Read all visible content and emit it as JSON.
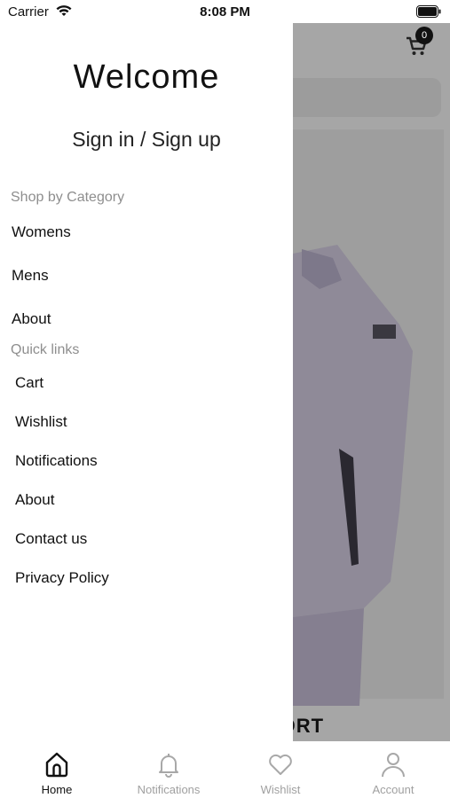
{
  "status_bar": {
    "carrier": "Carrier",
    "time": "8:08 PM"
  },
  "background": {
    "cart_count": "0",
    "hero_caption": "PORT"
  },
  "drawer": {
    "welcome": "Welcome",
    "signin": "Sign in / Sign up",
    "shop_label": "Shop by Category",
    "categories": [
      "Womens",
      "Mens",
      "About"
    ],
    "quick_label": "Quick links",
    "links": [
      "Cart",
      "Wishlist",
      "Notifications",
      "About",
      "Contact us",
      "Privacy Policy"
    ]
  },
  "tabs": [
    {
      "label": "Home",
      "icon": "home-icon",
      "active": true
    },
    {
      "label": "Notifications",
      "icon": "bell-icon",
      "active": false
    },
    {
      "label": "Wishlist",
      "icon": "heart-icon",
      "active": false
    },
    {
      "label": "Account",
      "icon": "person-icon",
      "active": false
    }
  ],
  "colors": {
    "dim_overlay": "#a6a6a6",
    "accent": "#111111",
    "muted": "#8e8e8e"
  }
}
